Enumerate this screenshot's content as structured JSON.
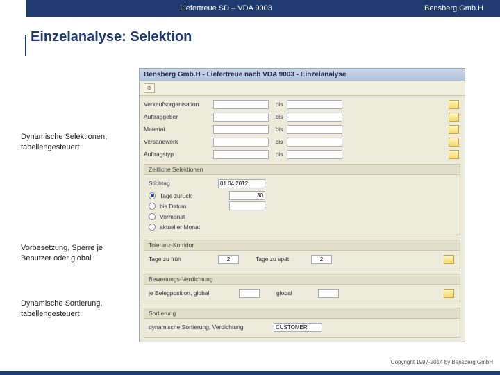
{
  "header": {
    "title": "Liefertreue SD – VDA 9003",
    "brand": "Bensberg Gmb.H"
  },
  "slide_title": "Einzelanalyse: Selektion",
  "side_labels": {
    "a": "Dynamische Selektionen,\ntabellengesteuert",
    "b": "Vorbesetzung, Sperre je\nBenutzer oder global",
    "c": "Dynamische Sortierung,\ntabellengesteuert"
  },
  "sap": {
    "window_title": "Bensberg Gmb.H - Liefertreue nach VDA 9003 - Einzelanalyse",
    "toolbar_icon": "⊕",
    "sel_rows": [
      {
        "label": "Verkaufsorganisation",
        "bis": "bis"
      },
      {
        "label": "Auftraggeber",
        "bis": "bis"
      },
      {
        "label": "Material",
        "bis": "bis"
      },
      {
        "label": "Versandwerk",
        "bis": "bis"
      },
      {
        "label": "Auftragstyp",
        "bis": "bis"
      }
    ],
    "group_time": {
      "title": "Zeitliche Selektionen",
      "stichtag_label": "Stichtag",
      "stichtag_value": "01.04.2012",
      "r1": "Tage zurück",
      "r1_val": "30",
      "r2": "bis Datum",
      "r3": "Vormonat",
      "r4": "aktueller Monat"
    },
    "group_tol": {
      "title": "Toleranz-Korridor",
      "l1": "Tage zu früh",
      "v1": "2",
      "l2": "Tage zu spät",
      "v2": "2"
    },
    "group_bew": {
      "title": "Bewertungs-Verdichtung",
      "l1": "je Belegposition, global",
      "l2": "global"
    },
    "group_sort": {
      "title": "Sortierung",
      "l1": "dynamische Sortierung, Verdichtung",
      "v1": "CUSTOMER"
    }
  },
  "copyright": "Copyright 1997-2014 by Bensberg GmbH"
}
